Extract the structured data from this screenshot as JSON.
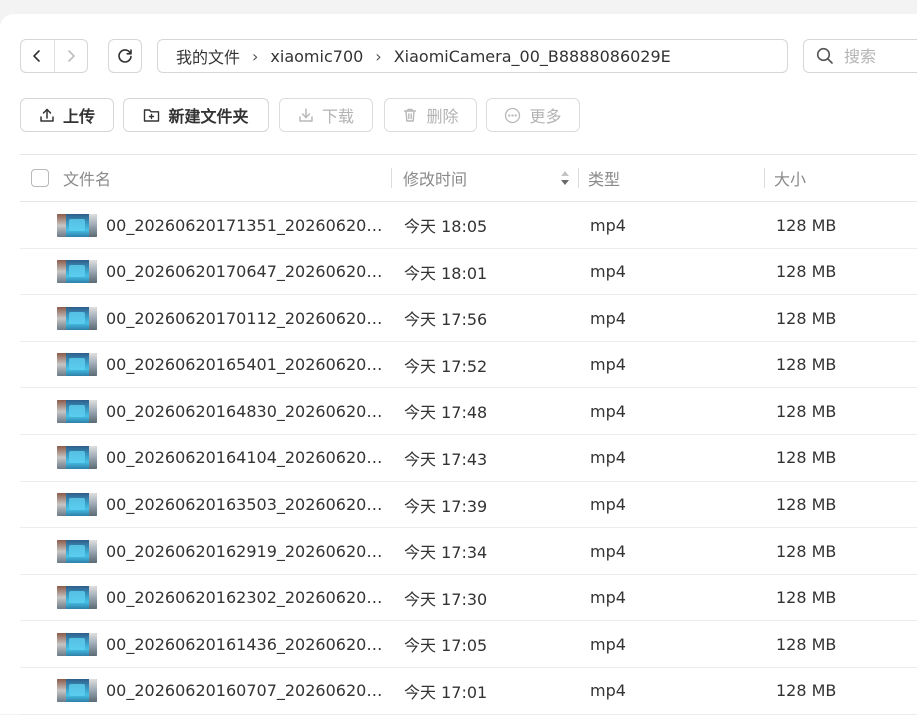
{
  "nav": {
    "back_icon": "chevron-left-icon",
    "forward_icon": "chevron-right-icon",
    "refresh_icon": "refresh-icon"
  },
  "breadcrumb": [
    "我的文件",
    "xiaomic700",
    "XiaomiCamera_00_B8888086029E"
  ],
  "search": {
    "placeholder": "搜索"
  },
  "toolbar": {
    "upload": "上传",
    "new_folder": "新建文件夹",
    "download": "下载",
    "delete": "删除",
    "more": "更多"
  },
  "columns": {
    "name": "文件名",
    "modified": "修改时间",
    "type": "类型",
    "size": "大小"
  },
  "files": [
    {
      "name": "00_20260620171351_20260620…",
      "modified": "今天 18:05",
      "type": "mp4",
      "size": "128 MB"
    },
    {
      "name": "00_20260620170647_20260620…",
      "modified": "今天 18:01",
      "type": "mp4",
      "size": "128 MB"
    },
    {
      "name": "00_20260620170112_20260620…",
      "modified": "今天 17:56",
      "type": "mp4",
      "size": "128 MB"
    },
    {
      "name": "00_20260620165401_20260620…",
      "modified": "今天 17:52",
      "type": "mp4",
      "size": "128 MB"
    },
    {
      "name": "00_20260620164830_20260620…",
      "modified": "今天 17:48",
      "type": "mp4",
      "size": "128 MB"
    },
    {
      "name": "00_20260620164104_20260620…",
      "modified": "今天 17:43",
      "type": "mp4",
      "size": "128 MB"
    },
    {
      "name": "00_20260620163503_20260620…",
      "modified": "今天 17:39",
      "type": "mp4",
      "size": "128 MB"
    },
    {
      "name": "00_20260620162919_20260620…",
      "modified": "今天 17:34",
      "type": "mp4",
      "size": "128 MB"
    },
    {
      "name": "00_20260620162302_20260620…",
      "modified": "今天 17:30",
      "type": "mp4",
      "size": "128 MB"
    },
    {
      "name": "00_20260620161436_20260620…",
      "modified": "今天 17:05",
      "type": "mp4",
      "size": "128 MB"
    },
    {
      "name": "00_20260620160707_20260620…",
      "modified": "今天 17:01",
      "type": "mp4",
      "size": "128 MB"
    }
  ]
}
